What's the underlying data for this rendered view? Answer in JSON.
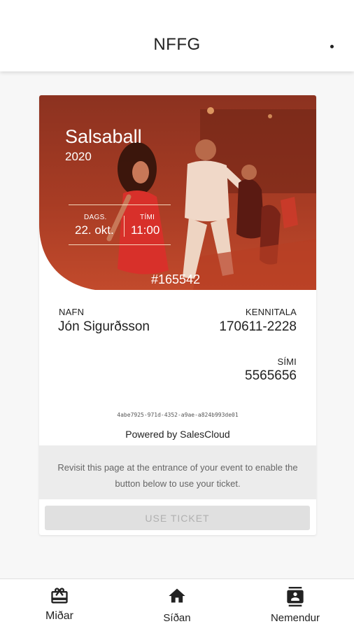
{
  "header": {
    "title": "NFFG",
    "menu_icon": "more-horizontal-icon"
  },
  "ticket": {
    "event_name": "Salsaball",
    "event_year": "2020",
    "date_label": "DAGS.",
    "date_value": "22. okt.",
    "time_label": "TÍMI",
    "time_value": "11:00",
    "ticket_number": "#165542",
    "name_label": "NAFN",
    "name_value": "Jón Sigurðsson",
    "kennitala_label": "KENNITALA",
    "kennitala_value": "170611-2228",
    "phone_label": "SÍMI",
    "phone_value": "5565656",
    "uuid": "4abe7925-971d-4352-a9ae-a824b993de01",
    "powered_by": "Powered by SalesCloud",
    "notice": "Revisit this page at the entrance of your event to enable the button below to use your ticket.",
    "use_button": "USE TICKET",
    "accent_color": "#c0462a"
  },
  "bottom_nav": {
    "items": [
      {
        "label": "Miðar",
        "icon": "gift-card-icon"
      },
      {
        "label": "Síðan",
        "icon": "home-icon"
      },
      {
        "label": "Nemendur",
        "icon": "contact-card-icon"
      }
    ]
  }
}
